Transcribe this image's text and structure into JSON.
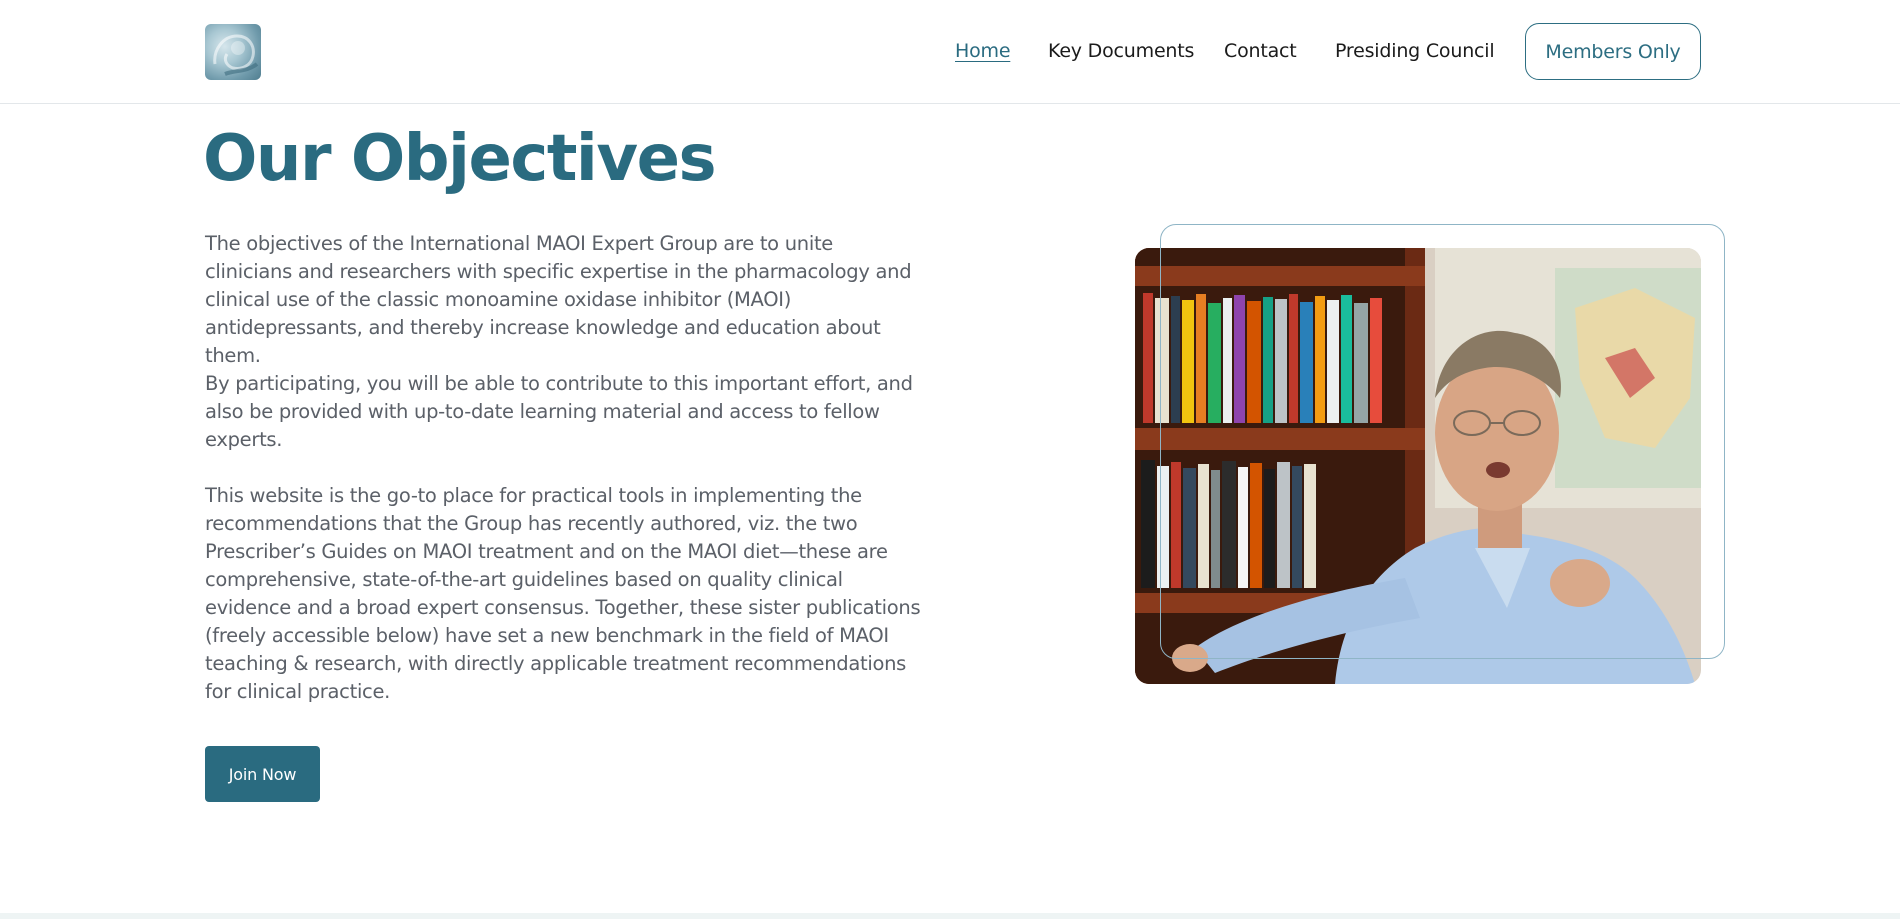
{
  "header": {
    "nav": [
      {
        "label": "Home",
        "active": true
      },
      {
        "label": "Key Documents",
        "active": false
      },
      {
        "label": "Contact",
        "active": false
      },
      {
        "label": "Presiding Council",
        "active": false
      }
    ],
    "members_label": "Members Only"
  },
  "main": {
    "title": "Our Objectives",
    "paragraph1": "The objectives of the International MAOI Expert Group are to unite clinicians and researchers with specific expertise in the pharmacology and clinical use of the classic monoamine oxidase inhibitor (MAOI) antidepressants, and thereby increase knowledge and education about them.",
    "paragraph2": "By participating, you will be able to contribute to this important effort, and also be provided with up-to-date learning material and access to fellow experts.",
    "paragraph3": "This website is the go-to place for practical tools in implementing the recommendations that the Group has recently authored, viz. the two Prescriber’s Guides on MAOI treatment and on the MAOI diet—these are comprehensive, state-of-the-art guidelines based on quality clinical evidence and a broad expert consensus. Together, these sister publications (freely accessible below) have set a new benchmark in the field of MAOI teaching & research, with directly applicable treatment recommendations for clinical practice.",
    "join_label": "Join Now"
  },
  "colors": {
    "brand": "#2a6b80",
    "body_text": "#5b6068",
    "frame": "#8fb5c6"
  }
}
